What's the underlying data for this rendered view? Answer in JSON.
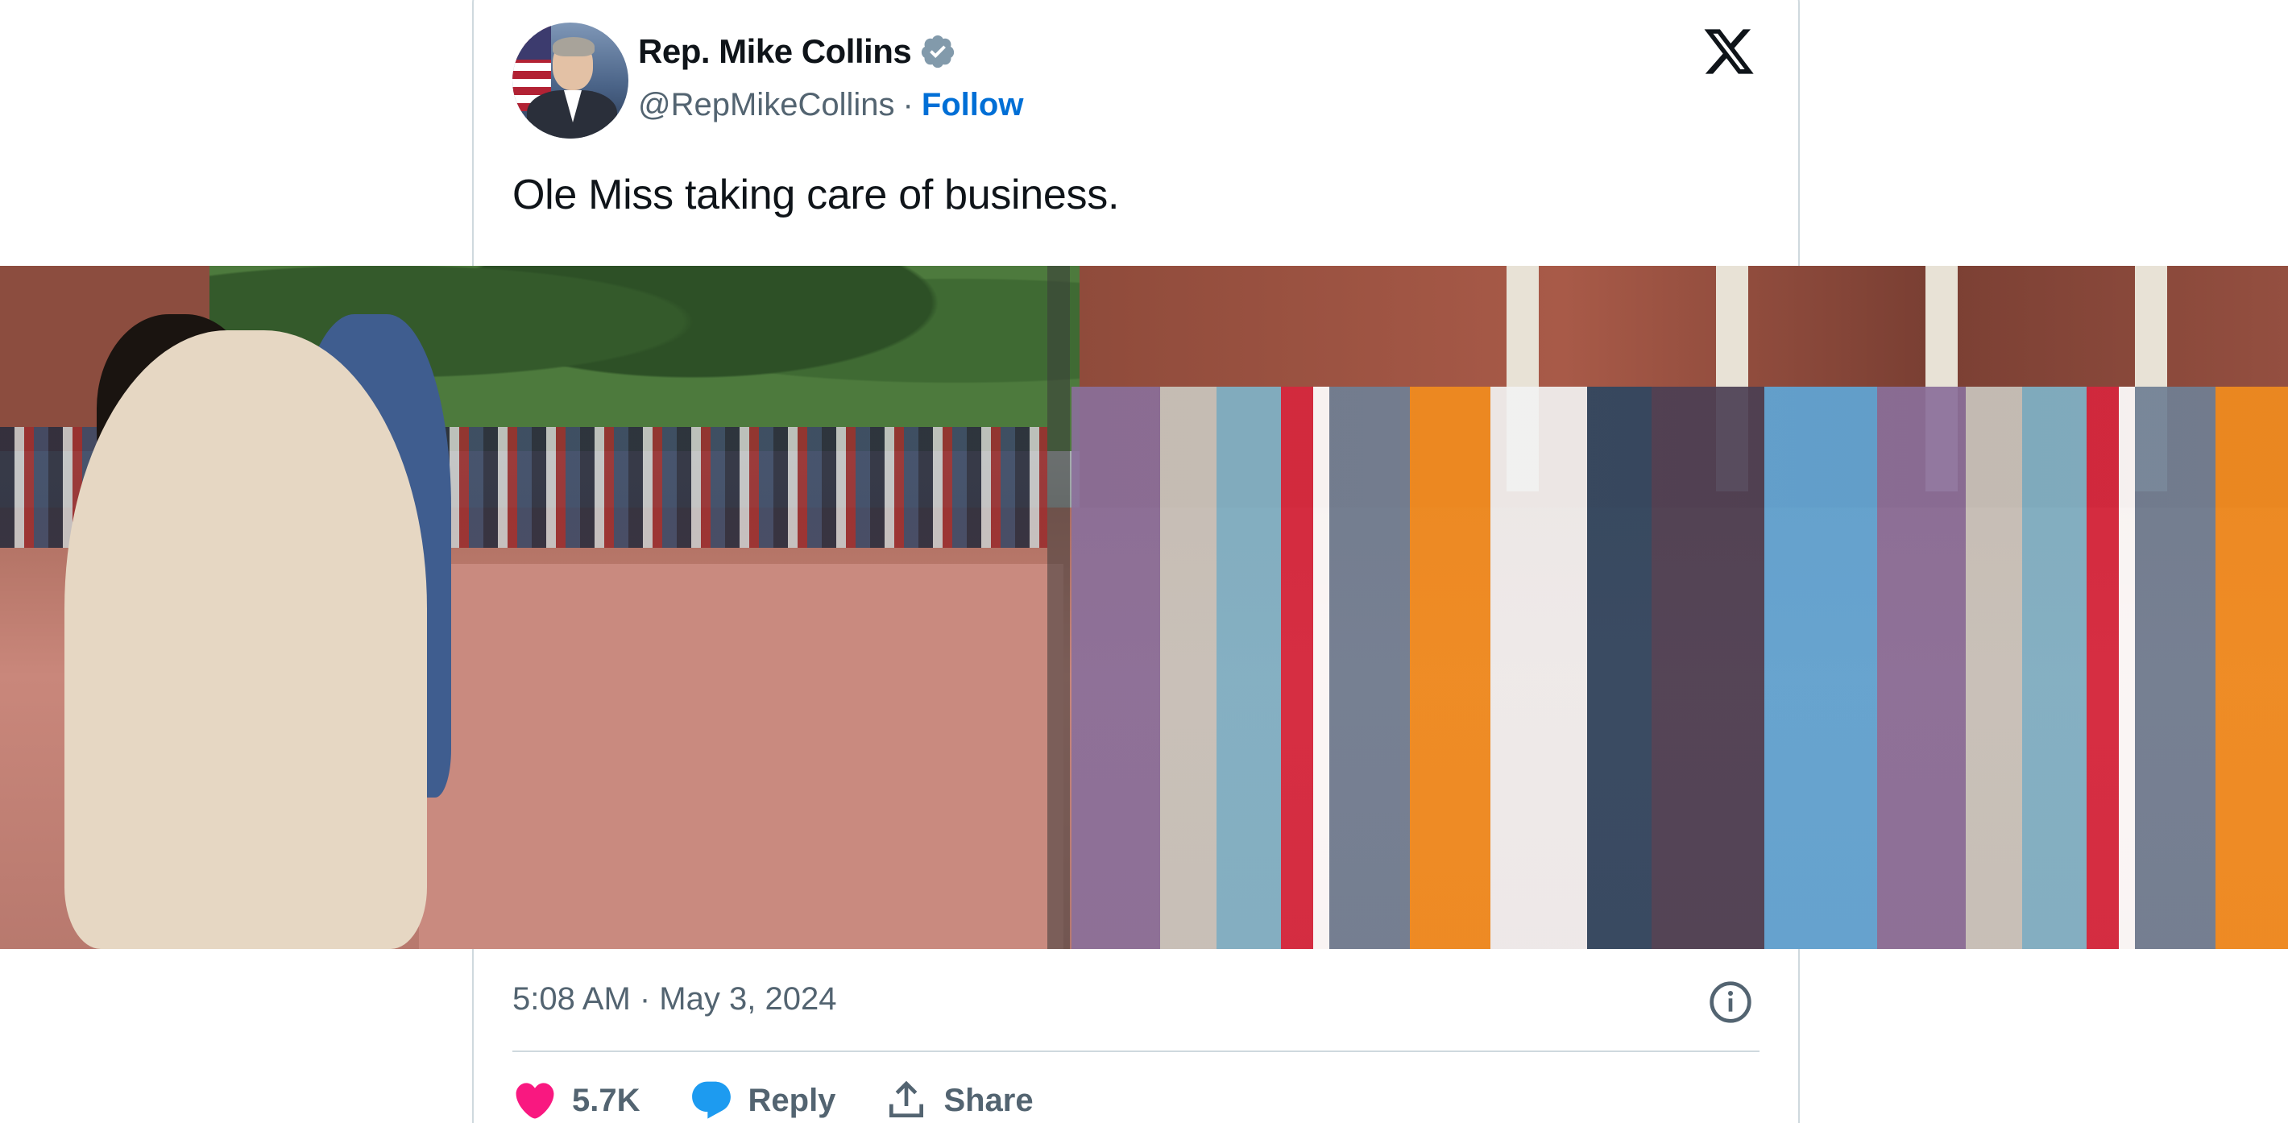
{
  "header": {
    "display_name": "Rep. Mike Collins",
    "handle": "@RepMikeCollins",
    "separator": "·",
    "follow_label": "Follow"
  },
  "tweet": {
    "text": "Ole Miss taking care of business."
  },
  "footer": {
    "timestamp": "5:08 AM · May 3, 2024",
    "likes": "5.7K",
    "reply_label": "Reply",
    "share_label": "Share"
  },
  "icons": {
    "logo": "x-logo-icon",
    "verified": "verified-badge-icon",
    "info": "info-icon",
    "like": "heart-icon",
    "reply": "reply-bubble-icon",
    "share": "share-icon"
  },
  "colors": {
    "link": "#006fd6",
    "muted": "#536471",
    "like": "#f91880",
    "reply": "#1d9bf0",
    "border": "#cfd9de"
  }
}
